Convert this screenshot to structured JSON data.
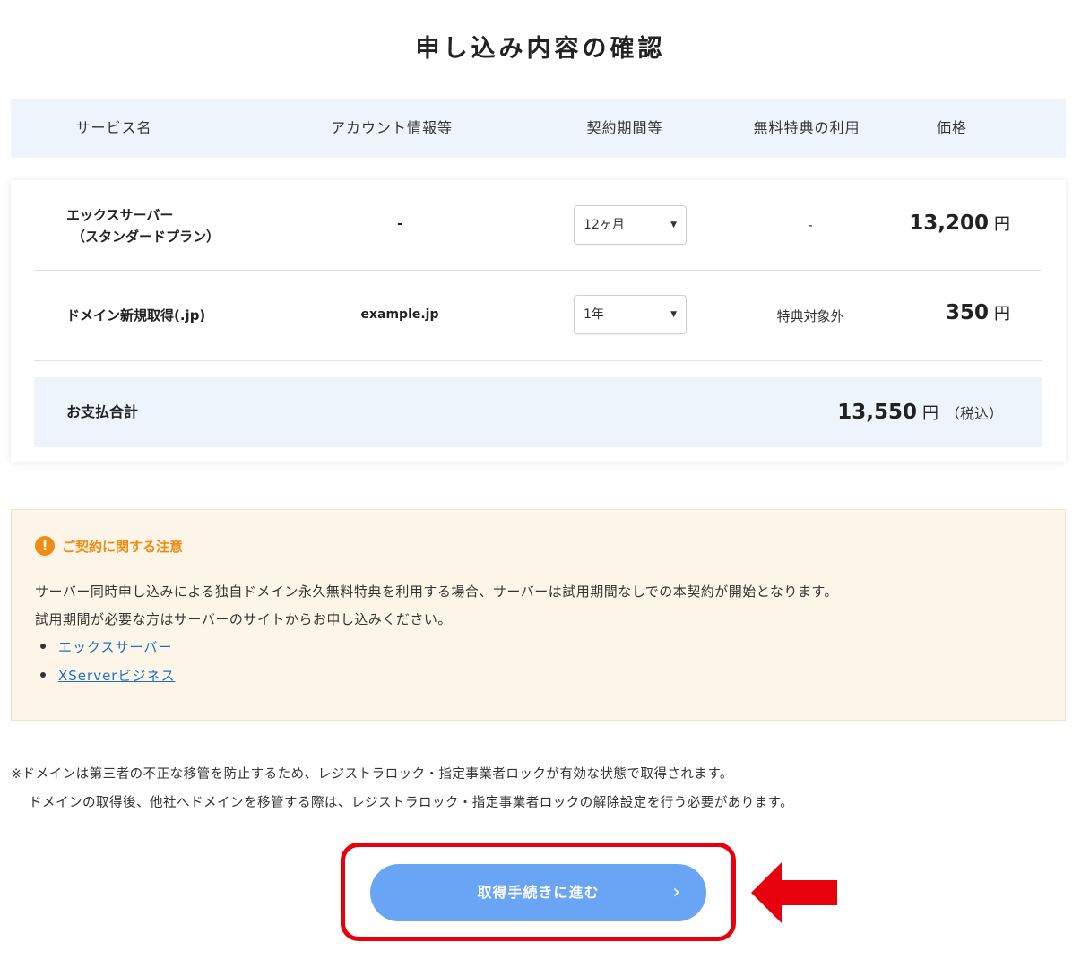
{
  "page": {
    "title": "申し込み内容の確認"
  },
  "table": {
    "headers": [
      "サービス名",
      "アカウント情報等",
      "契約期間等",
      "無料特典の利用",
      "価格"
    ],
    "rows": [
      {
        "service_line1": "エックスサーバー",
        "service_line2": "（スタンダードプラン）",
        "account": "-",
        "period": "12ヶ月",
        "perk": "-",
        "price": "13,200",
        "currency": "円"
      },
      {
        "service_line1": "ドメイン新規取得(.jp)",
        "account": "example.jp",
        "period": "1年",
        "perk": "特典対象外",
        "price": "350",
        "currency": "円"
      }
    ],
    "total": {
      "label": "お支払合計",
      "price": "13,550",
      "currency": "円",
      "tax_note": "（税込）"
    }
  },
  "notice": {
    "icon": "exclamation-circle-icon",
    "icon_glyph": "!",
    "title": "ご契約に関する注意",
    "text1": "サーバー同時申し込みによる独自ドメイン永久無料特典を利用する場合、サーバーは試用期間なしでの本契約が開始となります。",
    "text2": "試用期間が必要な方はサーバーのサイトからお申し込みください。",
    "links": [
      "エックスサーバー",
      "XServerビジネス"
    ]
  },
  "footnote": {
    "line1": "※ドメインは第三者の不正な移管を防止するため、レジストラロック・指定事業者ロックが有効な状態で取得されます。",
    "line2": "ドメインの取得後、他社へドメインを移管する際は、レジストラロック・指定事業者ロックの解除設定を行う必要があります。"
  },
  "action": {
    "proceed_label": "取得手続きに進む",
    "chevron": "›"
  },
  "colors": {
    "accent_button": "#6aa4f4",
    "highlight": "#e8000d",
    "notice_title": "#f08a12",
    "header_bg": "#eef4fc",
    "notice_bg": "#fdf6e8"
  }
}
